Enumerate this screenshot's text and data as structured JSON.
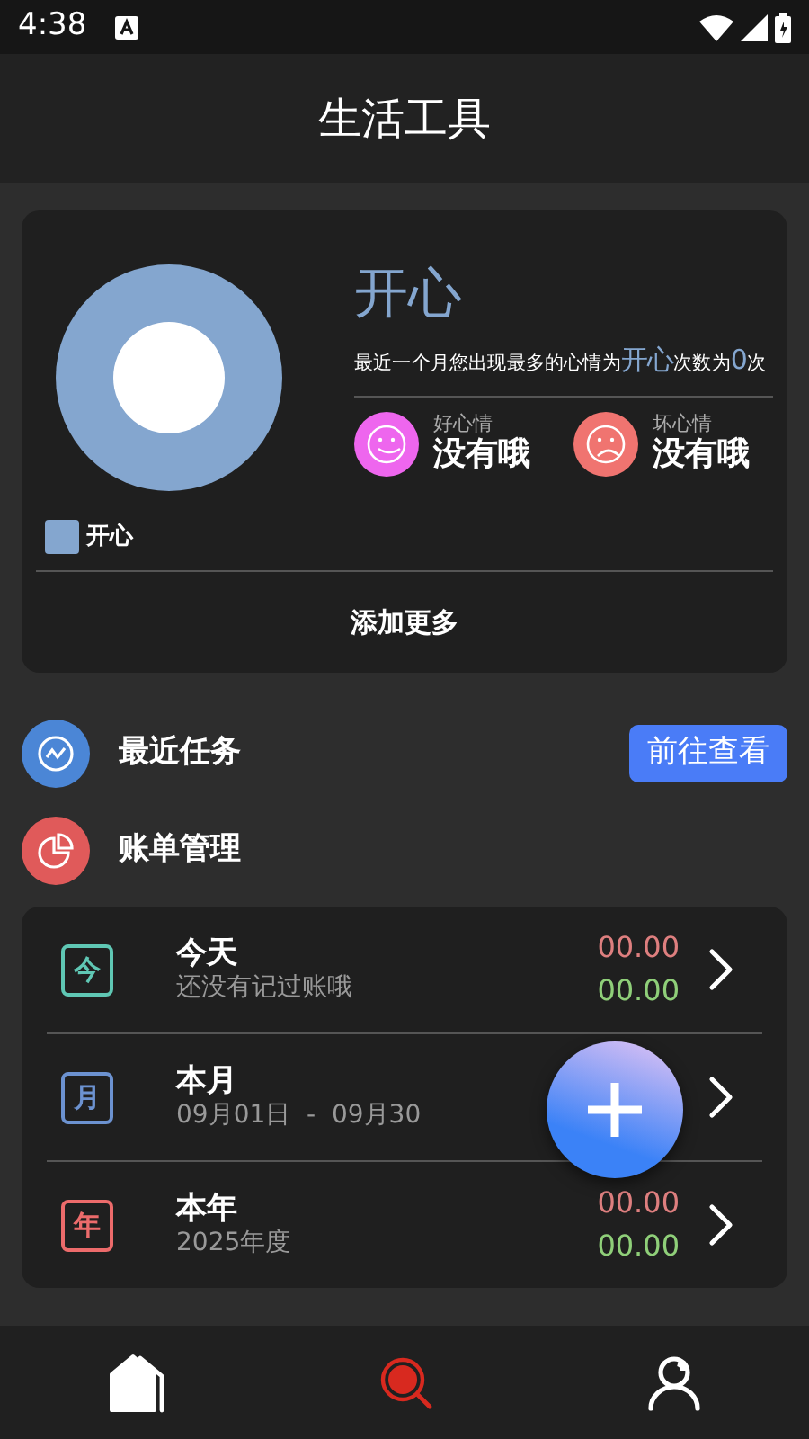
{
  "status_bar": {
    "time": "4:38"
  },
  "header": {
    "title": "生活工具"
  },
  "mood_card": {
    "mood": "开心",
    "summary": {
      "before": "最近一个月您出现最多的心情为",
      "mood": "开心",
      "middle": "次数为",
      "count": "0",
      "after": "次"
    },
    "stats": [
      {
        "kind": "good",
        "label": "好心情",
        "value": "没有哦",
        "color": "#ee66ee"
      },
      {
        "kind": "bad",
        "label": "坏心情",
        "value": "没有哦",
        "color": "#f07470"
      }
    ],
    "legend": [
      {
        "label": "开心",
        "color": "#84a6cf"
      }
    ],
    "more": "添加更多"
  },
  "sections": [
    {
      "kind": "tasks",
      "title": "最近任务",
      "color": "#4b86d6",
      "button": "前往查看"
    },
    {
      "kind": "bills",
      "title": "账单管理",
      "color": "#e05a5a"
    }
  ],
  "bills": [
    {
      "badge": "今",
      "color": "#5fc7b4",
      "title": "今天",
      "subtitle": "还没有记过账哦",
      "expense": "00.00",
      "income": "00.00"
    },
    {
      "badge": "月",
      "color": "#6c92d0",
      "title": "本月",
      "subtitle": "09月01日  -  09月30"
    },
    {
      "badge": "年",
      "color": "#ec6b6b",
      "title": "本年",
      "subtitle": "2025年度",
      "expense": "00.00",
      "income": "00.00"
    }
  ],
  "nav": [
    {
      "kind": "home",
      "selected": false
    },
    {
      "kind": "discover",
      "selected": true
    },
    {
      "kind": "profile",
      "selected": false
    }
  ]
}
